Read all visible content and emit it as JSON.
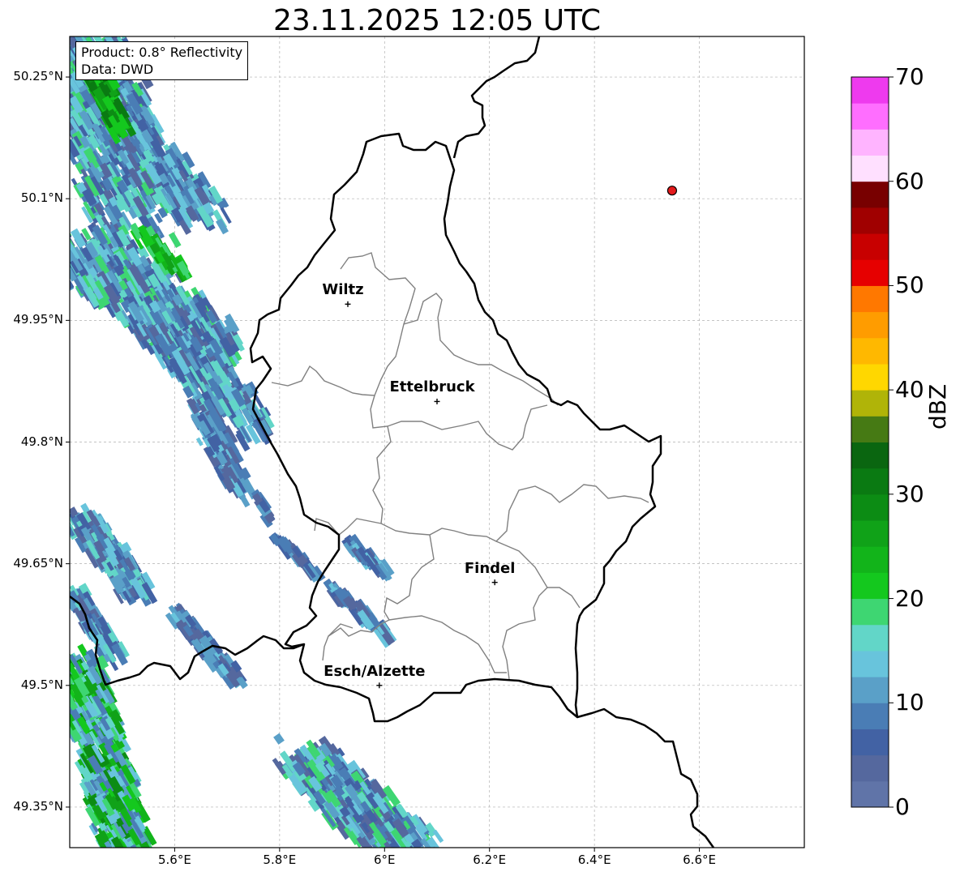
{
  "title": "23.11.2025 12:05 UTC",
  "info": {
    "product": "Product: 0.8° Reflectivity",
    "source": "Data: DWD"
  },
  "axes": {
    "x_ticks": [
      "5.6°E",
      "5.8°E",
      "6°E",
      "6.2°E",
      "6.4°E",
      "6.6°E"
    ],
    "y_ticks": [
      "50.25°N",
      "50.1°N",
      "49.95°N",
      "49.8°N",
      "49.65°N",
      "49.5°N",
      "49.35°N"
    ]
  },
  "cities": [
    {
      "name": "Wiltz",
      "lon": 5.93,
      "lat": 49.97
    },
    {
      "name": "Ettelbruck",
      "lon": 6.1,
      "lat": 49.85
    },
    {
      "name": "Findel",
      "lon": 6.21,
      "lat": 49.627
    },
    {
      "name": "Esch/Alzette",
      "lon": 5.99,
      "lat": 49.5
    }
  ],
  "radar_site": {
    "lon": 6.548,
    "lat": 50.11,
    "color": "#e31a1c"
  },
  "colorbar": {
    "label": "dBZ",
    "ticks": [
      "0",
      "10",
      "20",
      "30",
      "40",
      "50",
      "60",
      "70"
    ],
    "colors": [
      "#6074a8",
      "#55689e",
      "#4262a4",
      "#4a7db5",
      "#5aa0c8",
      "#68c4dc",
      "#62d6c8",
      "#3ed672",
      "#14c81e",
      "#12b41a",
      "#10a218",
      "#0c8c14",
      "#0a7a12",
      "#0a6610",
      "#467a14",
      "#b0b408",
      "#ffd700",
      "#ffb800",
      "#ff9c00",
      "#ff7800",
      "#e60000",
      "#c80000",
      "#a00000",
      "#780000",
      "#ffe0ff",
      "#ffb4ff",
      "#ff6eff",
      "#ee3aee"
    ]
  }
}
